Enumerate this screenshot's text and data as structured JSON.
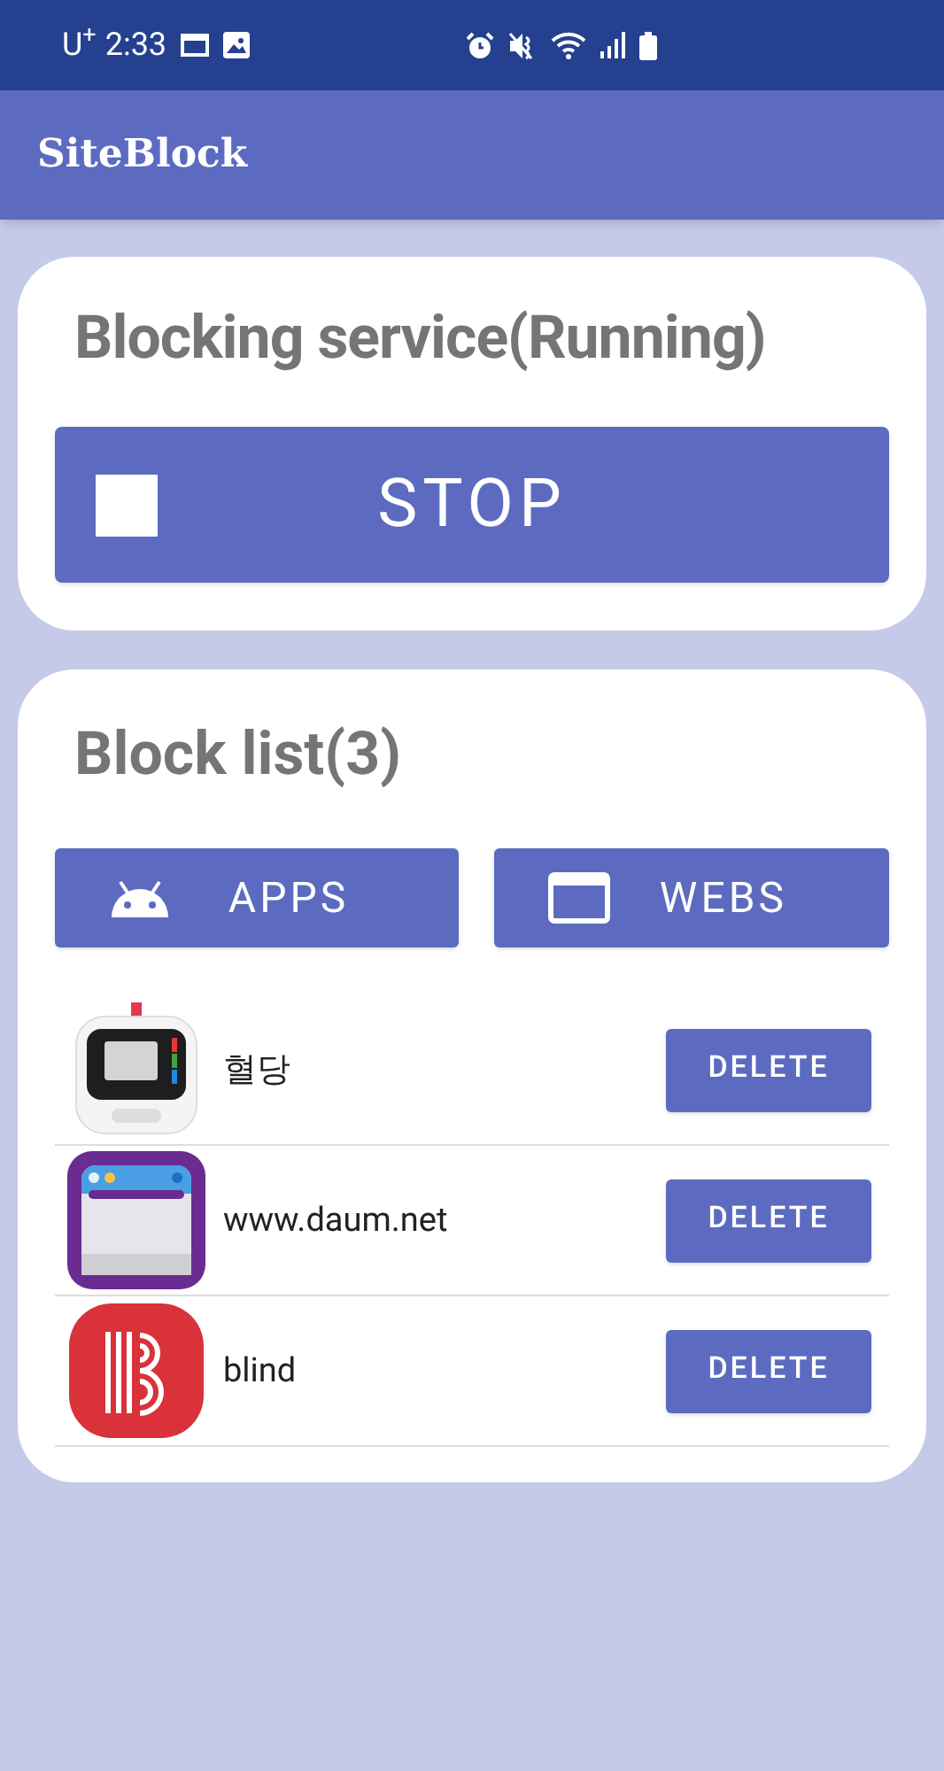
{
  "status_bar": {
    "carrier": "U$^{+}$",
    "time": "2:33"
  },
  "app_bar": {
    "title": "SiteBlock"
  },
  "service_card": {
    "title": "Blocking service(Running)",
    "button": "STOP"
  },
  "block_list": {
    "title": "Block list(3)",
    "buttons": [
      {
        "kind": "apps",
        "label": "APPS"
      },
      {
        "kind": "webs",
        "label": "WEBS"
      }
    ],
    "items": [
      {
        "name": "혈당",
        "action": "DELETE"
      },
      {
        "name": "www.daum.net",
        "action": "DELETE"
      },
      {
        "name": "blind",
        "action": "DELETE"
      }
    ]
  }
}
